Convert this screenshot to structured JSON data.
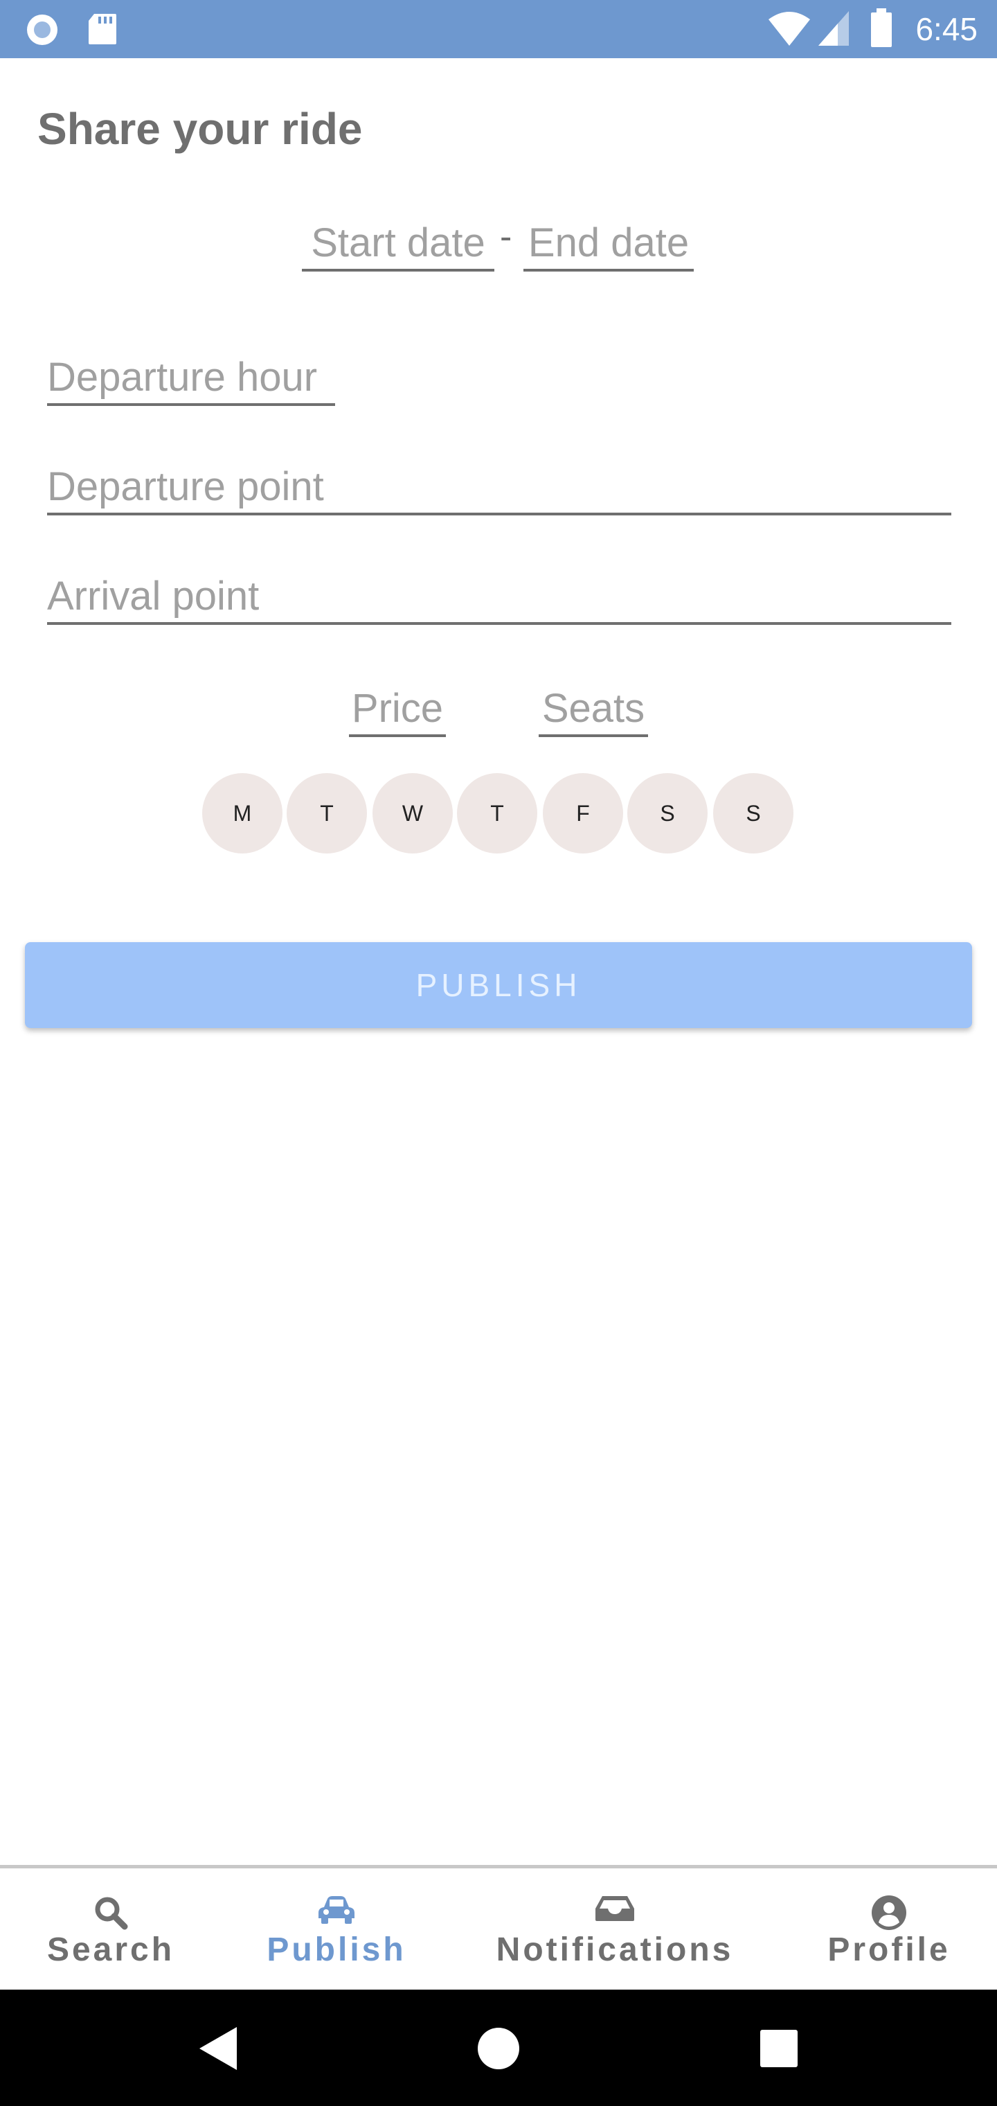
{
  "status_bar": {
    "time": "6:45",
    "left_icons": [
      "circle-app-icon",
      "sd-card-icon"
    ],
    "right_icons": [
      "wifi-icon",
      "cell-signal-icon",
      "battery-icon"
    ]
  },
  "page": {
    "title": "Share your ride"
  },
  "form": {
    "start_date_placeholder": "Start date",
    "date_separator": "-",
    "end_date_placeholder": "End date",
    "departure_hour_placeholder": "Departure hour",
    "departure_point_placeholder": "Departure point",
    "arrival_point_placeholder": "Arrival point",
    "price_placeholder": "Price",
    "seats_placeholder": "Seats"
  },
  "days": [
    "M",
    "T",
    "W",
    "T",
    "F",
    "S",
    "S"
  ],
  "publish_label": "PUBLISH",
  "bottom_nav": {
    "items": [
      {
        "label": "Search",
        "icon": "search-icon",
        "active": false
      },
      {
        "label": "Publish",
        "icon": "car-icon",
        "active": true
      },
      {
        "label": "Notifications",
        "icon": "inbox-icon",
        "active": false
      },
      {
        "label": "Profile",
        "icon": "account-circle-icon",
        "active": false
      }
    ]
  },
  "system_nav": [
    "back-icon",
    "home-icon",
    "recents-icon"
  ],
  "colors": {
    "accent": "#6e98cf",
    "publish_button": "#9ec3f9",
    "day_chip": "#efe7e5",
    "text_muted": "#6f6f6f"
  }
}
